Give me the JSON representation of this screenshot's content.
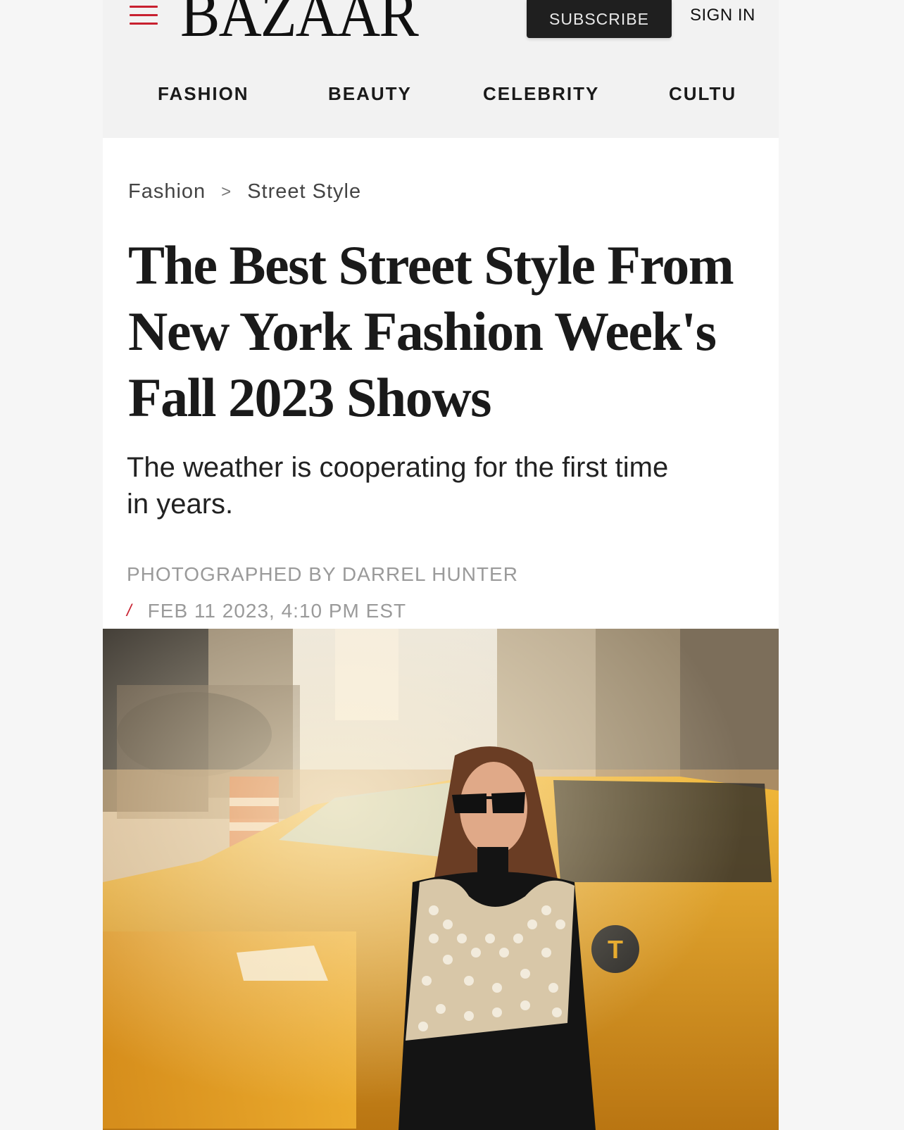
{
  "header": {
    "logo": "BAZAAR",
    "subscribe_label": "SUBSCRIBE",
    "signin_label": "SIGN IN"
  },
  "nav": {
    "items": [
      "FASHION",
      "BEAUTY",
      "CELEBRITY",
      "CULTU"
    ]
  },
  "breadcrumb": {
    "items": [
      "Fashion",
      "Street Style"
    ],
    "separator": ">"
  },
  "article": {
    "title_lines": [
      "The Best Street Style From",
      "New York Fashion Week's",
      "Fall 2023 Shows"
    ],
    "dek_lines": [
      "The weather is cooperating for the first time",
      "in years."
    ],
    "byline": "PHOTOGRAPHED BY DARREL HUNTER",
    "date_prefix": "/",
    "date": "FEB 11 2023, 4:10 PM EST"
  },
  "colors": {
    "accent": "#c8202f",
    "taxi": "#e3a21a",
    "text": "#1a1a1a"
  }
}
